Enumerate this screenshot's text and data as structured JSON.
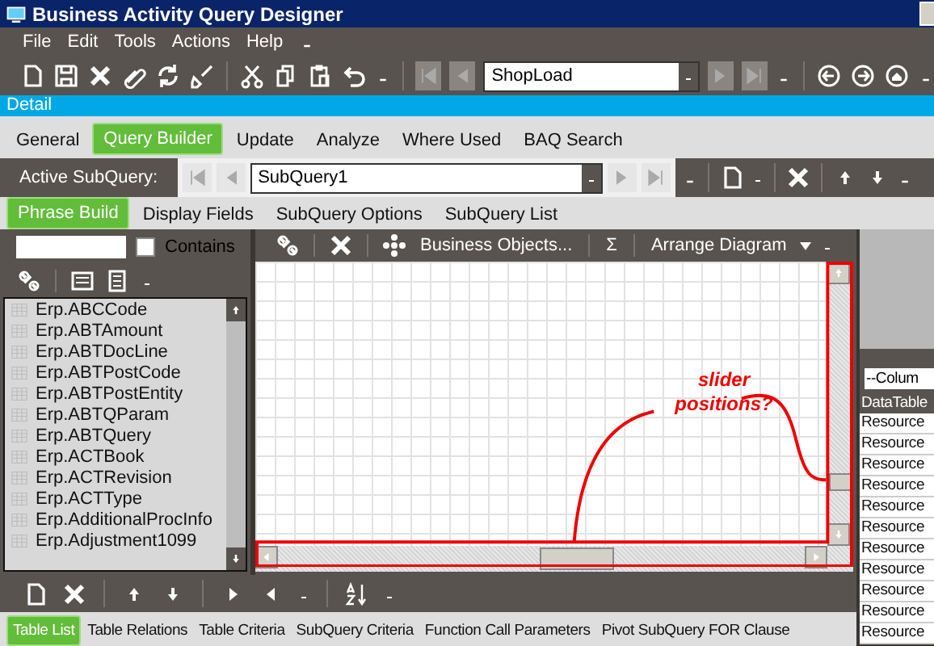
{
  "window": {
    "title": "Business Activity Query Designer"
  },
  "menu": [
    "File",
    "Edit",
    "Tools",
    "Actions",
    "Help"
  ],
  "toolbar": {
    "record_combo": "ShopLoad"
  },
  "detail_bar": {
    "label": "Detail"
  },
  "tabs": [
    {
      "label": "General",
      "selected": false
    },
    {
      "label": "Query Builder",
      "selected": true
    },
    {
      "label": "Update",
      "selected": false
    },
    {
      "label": "Analyze",
      "selected": false
    },
    {
      "label": "Where Used",
      "selected": false
    },
    {
      "label": "BAQ Search",
      "selected": false
    }
  ],
  "subquery_bar": {
    "label": "Active SubQuery:",
    "value": "SubQuery1"
  },
  "subtabs": [
    {
      "label": "Phrase Build",
      "selected": true
    },
    {
      "label": "Display Fields",
      "selected": false
    },
    {
      "label": "SubQuery Options",
      "selected": false
    },
    {
      "label": "SubQuery List",
      "selected": false
    }
  ],
  "table_search": {
    "contains_label": "Contains",
    "contains_checked": false
  },
  "tables": [
    "Erp.ABCCode",
    "Erp.ABTAmount",
    "Erp.ABTDocLine",
    "Erp.ABTPostCode",
    "Erp.ABTPostEntity",
    "Erp.ABTQParam",
    "Erp.ABTQuery",
    "Erp.ACTBook",
    "Erp.ACTRevision",
    "Erp.ACTType",
    "Erp.AdditionalProcInfo",
    "Erp.Adjustment1099"
  ],
  "diagram_toolbar": {
    "business_objects": "Business Objects...",
    "sum": "Σ",
    "arrange": "Arrange Diagram"
  },
  "annotation": {
    "text": "slider positions?"
  },
  "column_panel": {
    "column_combo": "--Colum",
    "header": "DataTable",
    "rows": [
      "Resource",
      "Resource",
      "Resource",
      "Resource",
      "Resource",
      "Resource",
      "Resource",
      "Resource",
      "Resource",
      "Resource",
      "Resource"
    ]
  },
  "bottom_tabs": [
    {
      "label": "Table List",
      "selected": true
    },
    {
      "label": "Table Relations",
      "selected": false
    },
    {
      "label": "Table Criteria",
      "selected": false
    },
    {
      "label": "SubQuery Criteria",
      "selected": false
    },
    {
      "label": "Function Call Parameters",
      "selected": false
    },
    {
      "label": "Pivot SubQuery FOR Clause",
      "selected": false
    }
  ]
}
